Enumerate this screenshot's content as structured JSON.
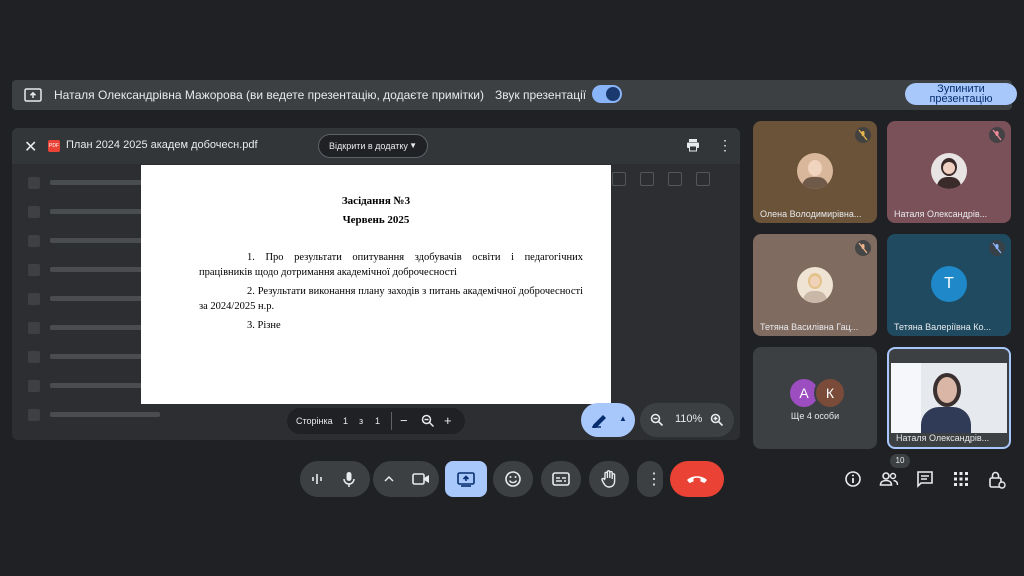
{
  "presentation_bar": {
    "title": "Наталя Олександрівна Мажорова (ви ведете презентацію, додаєте примітки)",
    "sound_label": "Звук презентації",
    "stop_line1": "Зупинити",
    "stop_line2": "презентацію"
  },
  "viewer": {
    "filename": "План 2024 2025 академ добочесн.pdf",
    "pdf_badge": "PDF",
    "open_in_app": "Відкрити в додатку"
  },
  "document": {
    "heading1": "Засідання №3",
    "heading2": "Червень 2025",
    "items": [
      "1. Про результати опитування здобувачів освіти і педагогічних працівників щодо дотримання академічної доброчесності",
      "2. Результати виконання плану заходів з питань академічної доброчесності за 2024/2025 н.р.",
      "3. Різне"
    ]
  },
  "pager": {
    "label": "Сторінка",
    "current": "1",
    "of": "з",
    "total": "1"
  },
  "zoom": {
    "value": "110%"
  },
  "participants": [
    {
      "name": "Олена Володимирівна...",
      "muted": true
    },
    {
      "name": "Наталя Олександрів...",
      "muted": true
    },
    {
      "name": "Тетяна Василівна Гац...",
      "muted": true
    },
    {
      "name": "Тетяна Валеріївна Ко...",
      "muted": true,
      "initial": "Т"
    },
    {
      "name": "Наталя Олександрів...",
      "muted": false
    }
  ],
  "others_tile": {
    "label": "Ще 4 особи",
    "initials": [
      "А",
      "К"
    ]
  },
  "people_count": "10",
  "colors": {
    "background": "#202124",
    "accent": "#a8c7fa",
    "hangup": "#ea4335"
  }
}
